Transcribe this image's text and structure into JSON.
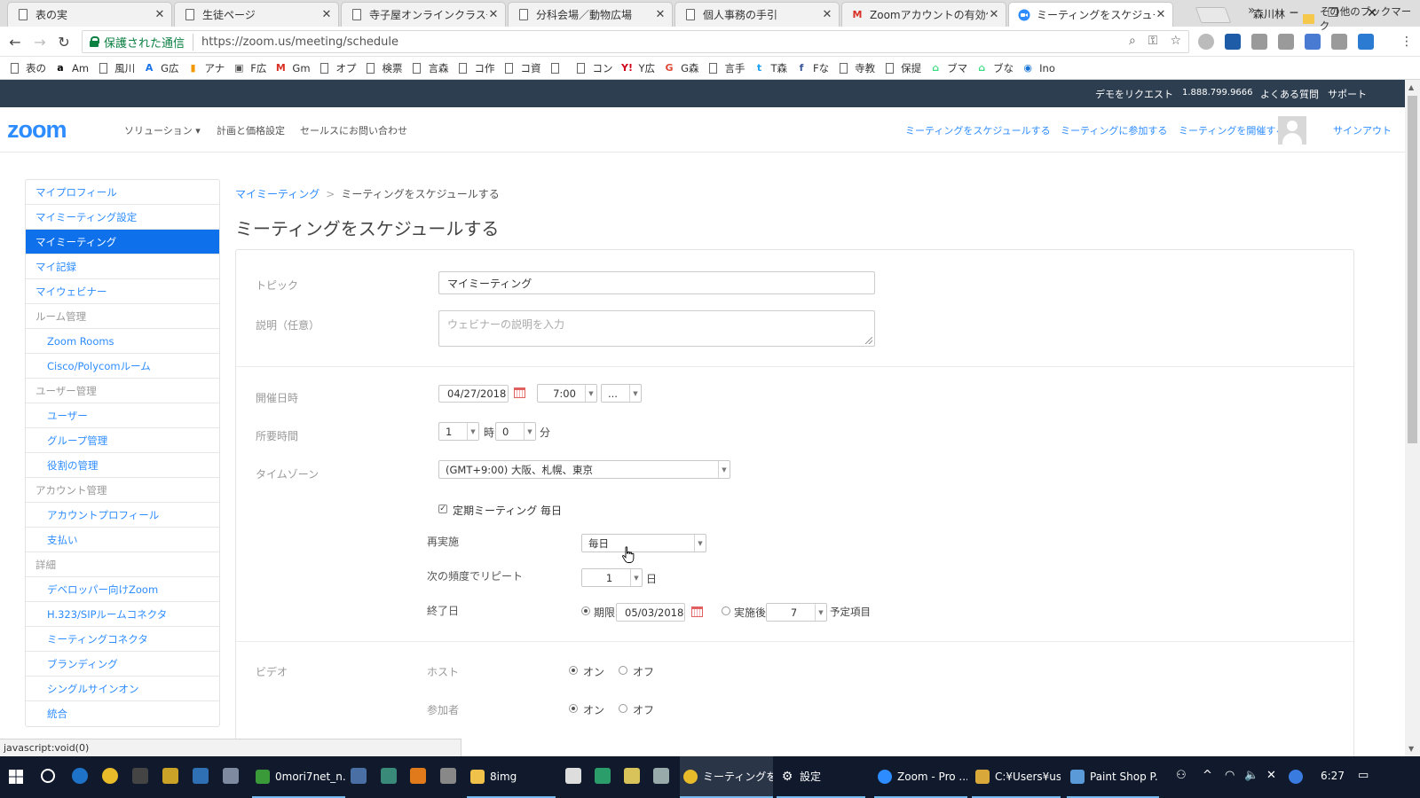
{
  "browser": {
    "tabs": [
      {
        "title": "表の実",
        "icon": "document-icon",
        "active": false
      },
      {
        "title": "生徒ページ",
        "icon": "document-icon",
        "active": false
      },
      {
        "title": "寺子屋オンラインクラス一覧",
        "icon": "document-icon",
        "active": false
      },
      {
        "title": "分科会場／動物広場",
        "icon": "document-icon",
        "active": false
      },
      {
        "title": "個人事務の手引",
        "icon": "document-icon",
        "active": false
      },
      {
        "title": "Zoomアカウントの有効化 -",
        "icon": "gmail-icon",
        "active": false
      },
      {
        "title": "ミーティングをスケジュールする",
        "icon": "zoom-icon",
        "active": true
      }
    ],
    "profile_name": "森川林",
    "security_label": "保護された通信",
    "url": "https://zoom.us/meeting/schedule",
    "bookmarks": [
      {
        "label": "表の",
        "icon": "document-icon"
      },
      {
        "label": "Am",
        "icon": "amazon-icon"
      },
      {
        "label": "風川",
        "icon": "document-icon"
      },
      {
        "label": "G広",
        "icon": "adwords-icon"
      },
      {
        "label": "アナ",
        "icon": "analytics-icon"
      },
      {
        "label": "F広",
        "icon": "bookmark-icon"
      },
      {
        "label": "Gm",
        "icon": "gmail-icon"
      },
      {
        "label": "オプ",
        "icon": "document-icon"
      },
      {
        "label": "検票",
        "icon": "document-icon"
      },
      {
        "label": "言森",
        "icon": "document-icon"
      },
      {
        "label": "コ作",
        "icon": "document-icon"
      },
      {
        "label": "コ資",
        "icon": "document-icon"
      },
      {
        "label": "",
        "icon": "document-icon"
      },
      {
        "label": "コン",
        "icon": "document-icon"
      },
      {
        "label": "Y広",
        "icon": "yahoo-icon"
      },
      {
        "label": "G森",
        "icon": "google-plus-icon"
      },
      {
        "label": "言手",
        "icon": "document-icon"
      },
      {
        "label": "T森",
        "icon": "twitter-icon"
      },
      {
        "label": "Fな",
        "icon": "facebook-icon"
      },
      {
        "label": "寺教",
        "icon": "document-icon"
      },
      {
        "label": "保提",
        "icon": "document-icon"
      },
      {
        "label": "ブマ",
        "icon": "android-icon"
      },
      {
        "label": "ブな",
        "icon": "android-icon"
      },
      {
        "label": "Ino",
        "icon": "inoreader-icon"
      }
    ],
    "bookmarks_more": "»",
    "other_bookmarks": "その他のブックマーク",
    "status_text": "javascript:void(0)"
  },
  "zoom": {
    "topbar": {
      "demo": "デモをリクエスト",
      "phone": "1.888.799.9666",
      "faq": "よくある質問",
      "support": "サポート"
    },
    "logo": "zoom",
    "nav_left": [
      "ソリューション ▾",
      "計画と価格設定",
      "セールスにお問い合わせ"
    ],
    "nav_right": {
      "schedule": "ミーティングをスケジュールする",
      "join": "ミーティングに参加する",
      "host": "ミーティングを開催する ▾",
      "signout": "サインアウト"
    },
    "sidebar": [
      {
        "label": "マイプロフィール",
        "kind": "link"
      },
      {
        "label": "マイミーティング設定",
        "kind": "link"
      },
      {
        "label": "マイミーティング",
        "kind": "active"
      },
      {
        "label": "マイ記録",
        "kind": "link"
      },
      {
        "label": "マイウェビナー",
        "kind": "link"
      },
      {
        "label": "ルーム管理",
        "kind": "header"
      },
      {
        "label": "Zoom Rooms",
        "kind": "sub"
      },
      {
        "label": "Cisco/Polycomルーム",
        "kind": "sub"
      },
      {
        "label": "ユーザー管理",
        "kind": "header"
      },
      {
        "label": "ユーザー",
        "kind": "sub"
      },
      {
        "label": "グループ管理",
        "kind": "sub"
      },
      {
        "label": "役割の管理",
        "kind": "sub"
      },
      {
        "label": "アカウント管理",
        "kind": "header"
      },
      {
        "label": "アカウントプロフィール",
        "kind": "sub"
      },
      {
        "label": "支払い",
        "kind": "sub"
      },
      {
        "label": "詳細",
        "kind": "header"
      },
      {
        "label": "デベロッパー向けZoom",
        "kind": "sub"
      },
      {
        "label": "H.323/SIPルームコネクタ",
        "kind": "sub"
      },
      {
        "label": "ミーティングコネクタ",
        "kind": "sub"
      },
      {
        "label": "ブランディング",
        "kind": "sub"
      },
      {
        "label": "シングルサインオン",
        "kind": "sub"
      },
      {
        "label": "統合",
        "kind": "sub"
      }
    ],
    "breadcrumb": {
      "parent": "マイミーティング",
      "separator": ">",
      "current": "ミーティングをスケジュールする"
    },
    "page_title": "ミーティングをスケジュールする",
    "form": {
      "topic_label": "トピック",
      "topic_value": "マイミーティング",
      "description_label": "説明（任意）",
      "description_placeholder": "ウェビナーの説明を入力",
      "when_label": "開催日時",
      "date_value": "04/27/2018",
      "time_value": "7:00",
      "ampm_value": "...",
      "duration_label": "所要時間",
      "duration_hours": "1",
      "hours_unit": "時",
      "duration_minutes": "0",
      "minutes_unit": "分",
      "timezone_label": "タイムゾーン",
      "timezone_value": "(GMT+9:00) 大阪、札幌、東京",
      "recurring_label": "定期ミーティング",
      "recurring_checked": true,
      "recurring_summary": "毎日",
      "recurrence_label": "再実施",
      "recurrence_value": "毎日",
      "repeat_every_label": "次の頻度でリピート",
      "repeat_every_value": "1",
      "repeat_every_unit": "日",
      "end_label": "終了日",
      "end_by_label": "期限",
      "end_by_selected": true,
      "end_date_value": "05/03/2018",
      "end_after_label": "実施後",
      "end_after_value": "7",
      "end_after_unit": "予定項目",
      "video_label": "ビデオ",
      "host_label": "ホスト",
      "participants_label": "参加者",
      "on_label": "オン",
      "off_label": "オフ",
      "host_video_on": true,
      "participants_video_on": true
    }
  },
  "taskbar": {
    "tasks": [
      {
        "label": "0mori7net_n...",
        "icon": "terminal-icon"
      },
      {
        "label": "8img",
        "icon": "folder-icon"
      },
      {
        "label": "ミーティングをス...",
        "icon": "chrome-icon"
      },
      {
        "label": "設定",
        "icon": "gear-icon"
      },
      {
        "label": "Zoom - Pro ...",
        "icon": "zoom-icon"
      },
      {
        "label": "C:¥Users¥us...",
        "icon": "explorer-icon"
      },
      {
        "label": "Paint Shop P...",
        "icon": "paintshop-icon"
      }
    ],
    "clock": "6:27"
  },
  "colors": {
    "zoom_blue": "#2d8cff",
    "active_menu": "#0e71eb",
    "topbar": "#2d3e50",
    "taskbar": "#101a2c",
    "secure_green": "#0b8043"
  }
}
